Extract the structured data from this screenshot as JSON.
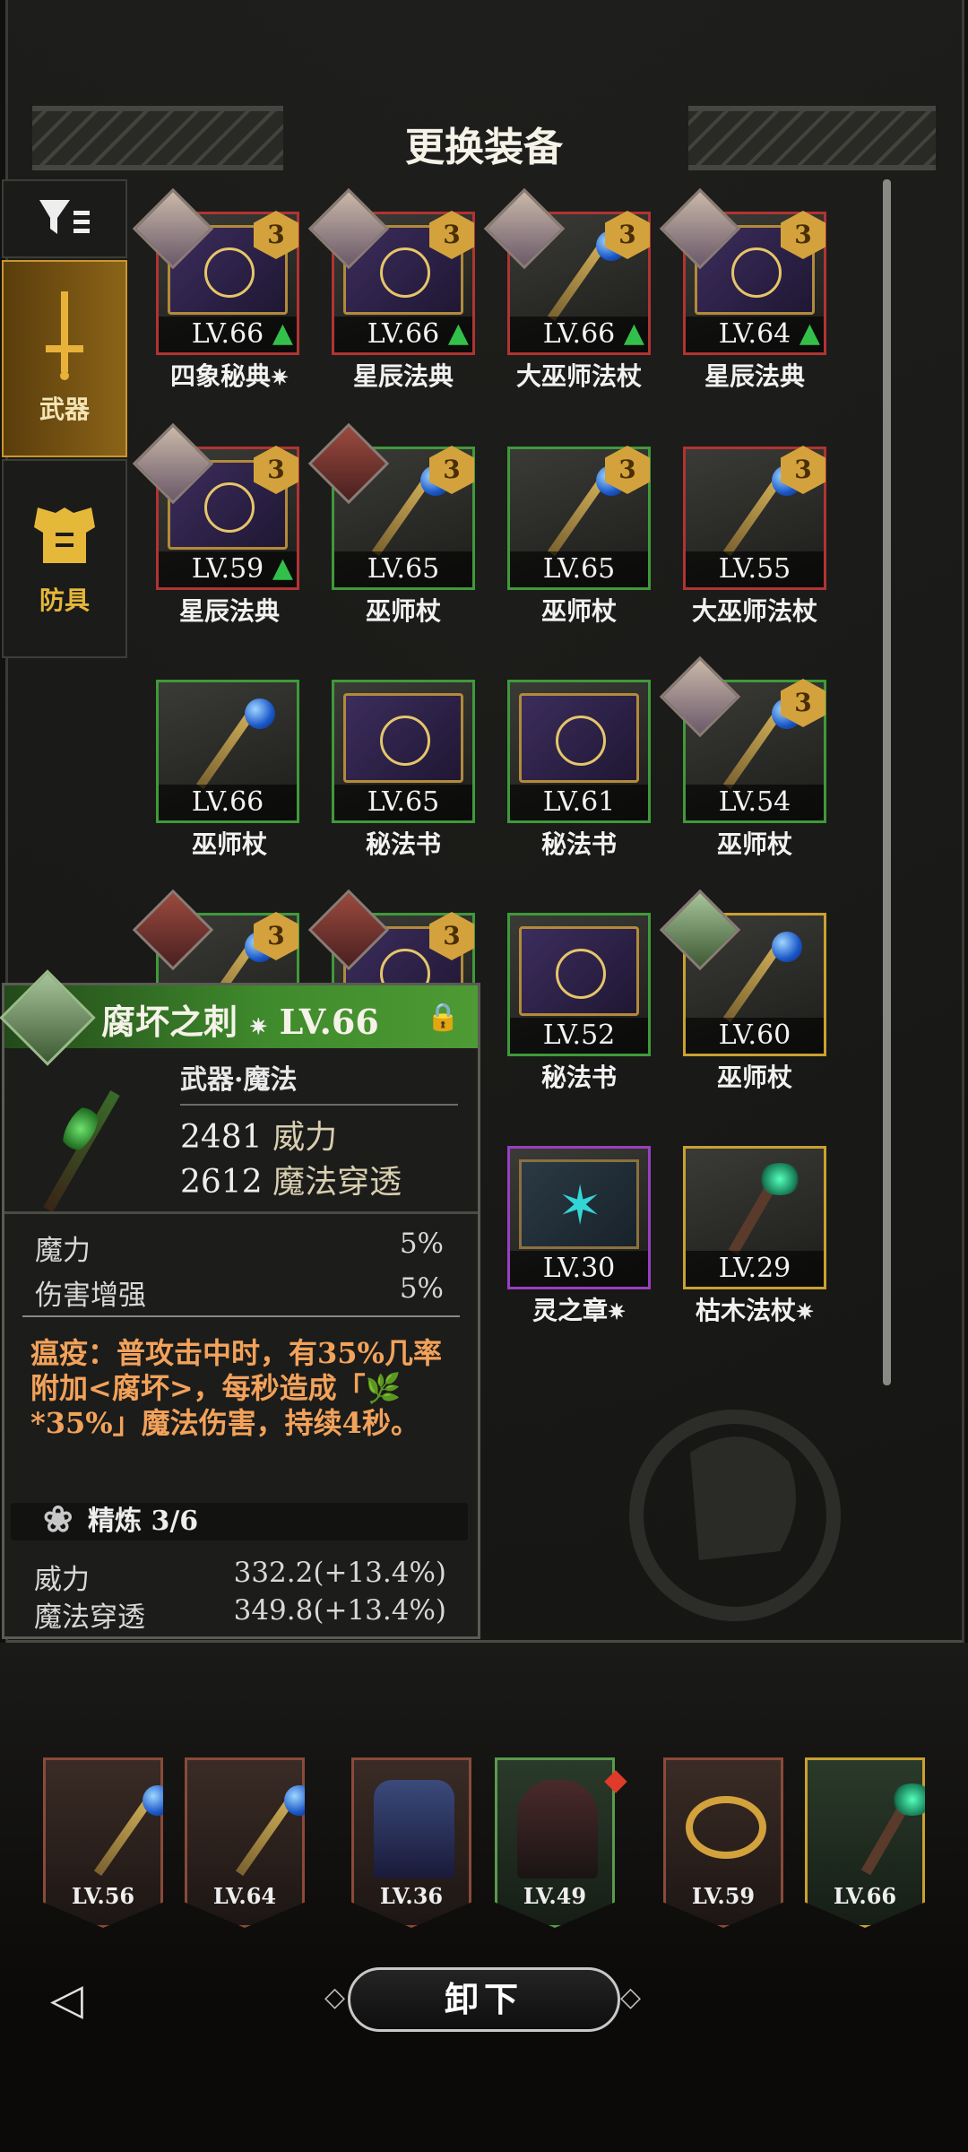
{
  "header": {
    "title": "更换装备"
  },
  "tabs": [
    {
      "label": "武器"
    },
    {
      "label": "防具"
    }
  ],
  "grid": [
    {
      "level": "LV.66",
      "name": "四象秘典",
      "star": "✷"
    },
    {
      "level": "LV.66",
      "name": "星辰法典"
    },
    {
      "level": "LV.66",
      "name": "大巫师法杖"
    },
    {
      "level": "LV.64",
      "name": "星辰法典"
    },
    {
      "level": "LV.59",
      "name": "星辰法典"
    },
    {
      "level": "LV.65",
      "name": "巫师杖"
    },
    {
      "level": "LV.65",
      "name": "巫师杖"
    },
    {
      "level": "LV.55",
      "name": "大巫师法杖"
    },
    {
      "level": "LV.66",
      "name": "巫师杖"
    },
    {
      "level": "LV.65",
      "name": "秘法书"
    },
    {
      "level": "LV.61",
      "name": "秘法书"
    },
    {
      "level": "LV.54",
      "name": "巫师杖"
    },
    {
      "level": "LV.52",
      "name": "秘法书"
    },
    {
      "level": "LV.60",
      "name": "巫师杖"
    },
    {
      "level": "LV.30",
      "name": "灵之章",
      "star": "✷"
    },
    {
      "level": "LV.29",
      "name": "枯木法杖",
      "star": "✷"
    }
  ],
  "rank": "3",
  "tooltip": {
    "name": "腐坏之刺",
    "star": "✷",
    "level": "LV.66",
    "type": "武器·魔法",
    "stats": [
      {
        "value": "2481",
        "label": "威力"
      },
      {
        "value": "2612",
        "label": "魔法穿透"
      }
    ],
    "bonus": [
      {
        "label": "魔力",
        "value": "5%"
      },
      {
        "label": "伤害增强",
        "value": "5%"
      }
    ],
    "description": "瘟疫：普攻击中时，有35%几率附加<腐坏>，每秒造成「🌿*35%」魔法伤害，持续4秒。",
    "refine": "精炼 3/6",
    "refine_stats": [
      {
        "label": "威力",
        "value": "332.2(+13.4%)"
      },
      {
        "label": "魔法穿透",
        "value": "349.8(+13.4%)"
      }
    ]
  },
  "equipped": [
    {
      "level": "LV.56"
    },
    {
      "level": "LV.64"
    },
    {
      "level": "LV.36"
    },
    {
      "level": "LV.49"
    },
    {
      "level": "LV.59"
    },
    {
      "level": "LV.66"
    }
  ],
  "actions": {
    "unequip": "卸下"
  },
  "colors": {
    "red": "#b03432",
    "green": "#3f9a3a",
    "purple": "#9a3fc0",
    "gold": "#caa030",
    "accent": "#c9962e"
  }
}
